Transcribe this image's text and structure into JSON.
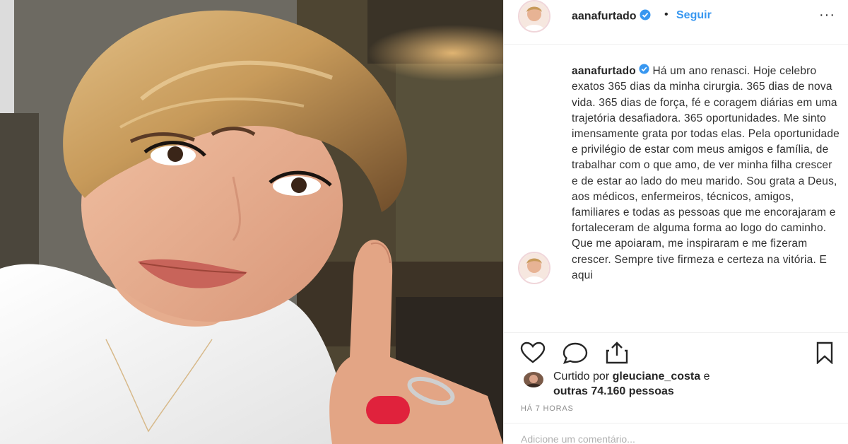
{
  "post": {
    "username": "aanafurtado",
    "dot": "•",
    "follow_label": "Seguir",
    "more_label": "···",
    "caption": "Há um ano renasci. Hoje celebro exatos 365 dias da minha cirurgia. 365 dias de nova vida. 365 dias de força, fé e coragem diárias em uma trajetória desafiadora. 365 oportunidades. Me sinto imensamente grata por todas elas. Pela oportunidade e privilégio de estar com meus amigos e família, de trabalhar com o que amo, de ver minha filha crescer e de estar ao lado do meu marido. Sou grata a Deus, aos médicos, enfermeiros, técnicos, amigos, familiares e todas as pessoas que me encorajaram e fortaleceram de alguma forma ao logo do caminho. Que me apoiaram, me inspiraram e me fizeram crescer. Sempre tive firmeza e certeza na vitória. E aqui",
    "likes_prefix": "Curtido por",
    "liked_by": "gleuciane_costa",
    "likes_conj": "e",
    "likes_rest": "outras 74.160 pessoas",
    "time": "HÁ 7 HORAS",
    "comment_placeholder": "Adicione um comentário..."
  },
  "icons": {
    "verified": "verified-badge",
    "like": "heart-outline",
    "comment": "speech-bubble",
    "share": "share-arrow",
    "save": "bookmark-outline"
  },
  "colors": {
    "accent": "#3897f0",
    "verified": "#3897f0",
    "nail": "#e0223c"
  }
}
